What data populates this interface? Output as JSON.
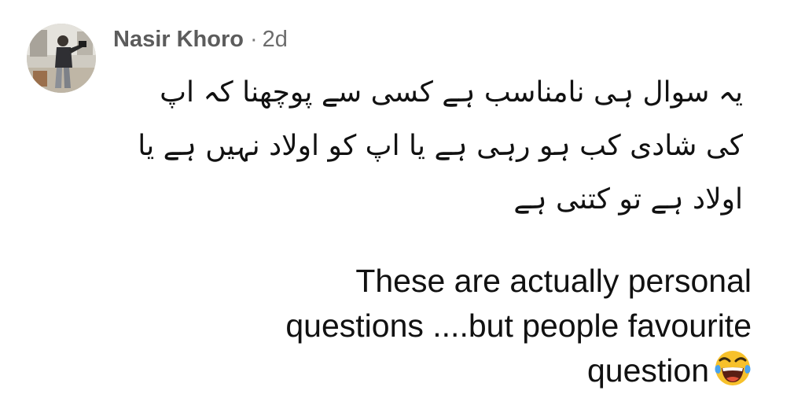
{
  "comment": {
    "author": "Nasir Khoro",
    "separator": "·",
    "time": "2d",
    "urdu_lines": [
      "یہ سوال ہی نامناسب ہے کسی سے پوچھنا کہ اپ",
      "کی شادی کب ہو رہی ہے یا اپ کو اولاد نہیں ہے یا",
      "اولاد ہے تو کتنی ہے"
    ],
    "english_lines": [
      "These are actually personal",
      "questions ....but people favourite",
      "question"
    ],
    "emoji": "laughing-with-tears-emoji"
  },
  "colors": {
    "author": "#5c5c5c",
    "text": "#111111",
    "emoji_face": "#f7c12b",
    "emoji_tears": "#4aa3ee"
  }
}
